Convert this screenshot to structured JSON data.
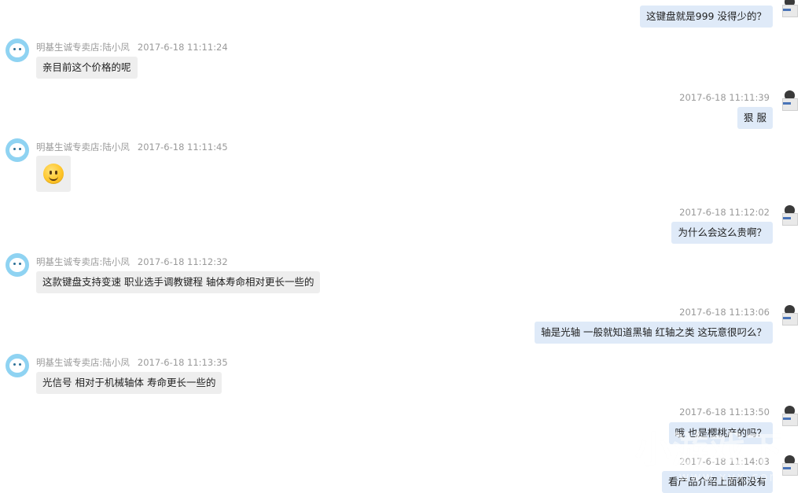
{
  "messages": [
    {
      "side": "right",
      "text": "这键盘就是999  没得少的？"
    },
    {
      "side": "left",
      "sender": "明基生诚专卖店:陆小凤",
      "time": "2017-6-18 11:11:24",
      "text": "亲目前这个价格的呢"
    },
    {
      "side": "right",
      "time": "2017-6-18 11:11:39",
      "text": "狠  服"
    },
    {
      "side": "left",
      "sender": "明基生诚专卖店:陆小凤",
      "time": "2017-6-18 11:11:45",
      "emoji": "smile-emoji"
    },
    {
      "side": "right",
      "time": "2017-6-18 11:12:02",
      "text": "为什么会这么贵啊？"
    },
    {
      "side": "left",
      "sender": "明基生诚专卖店:陆小凤",
      "time": "2017-6-18 11:12:32",
      "text": "这款键盘支持变速    职业选手调教键程     轴体寿命相对更长一些的"
    },
    {
      "side": "right",
      "time": "2017-6-18 11:13:06",
      "text": "轴是光轴  一般就知道黑轴 红轴之类 这玩意很叼么？"
    },
    {
      "side": "left",
      "sender": "明基生诚专卖店:陆小凤",
      "time": "2017-6-18 11:13:35",
      "text": "光信号   相对于机械轴体  寿命更长一些的"
    },
    {
      "side": "right",
      "time": "2017-6-18 11:13:50",
      "text": "哦  也是樱桃产的吗？"
    },
    {
      "side": "right",
      "time": "2017-6-18 11:14:03",
      "text": "看产品介绍上面都没有"
    }
  ],
  "watermark": {
    "main": "小游戏下",
    "sub": "www.xyx.com"
  }
}
